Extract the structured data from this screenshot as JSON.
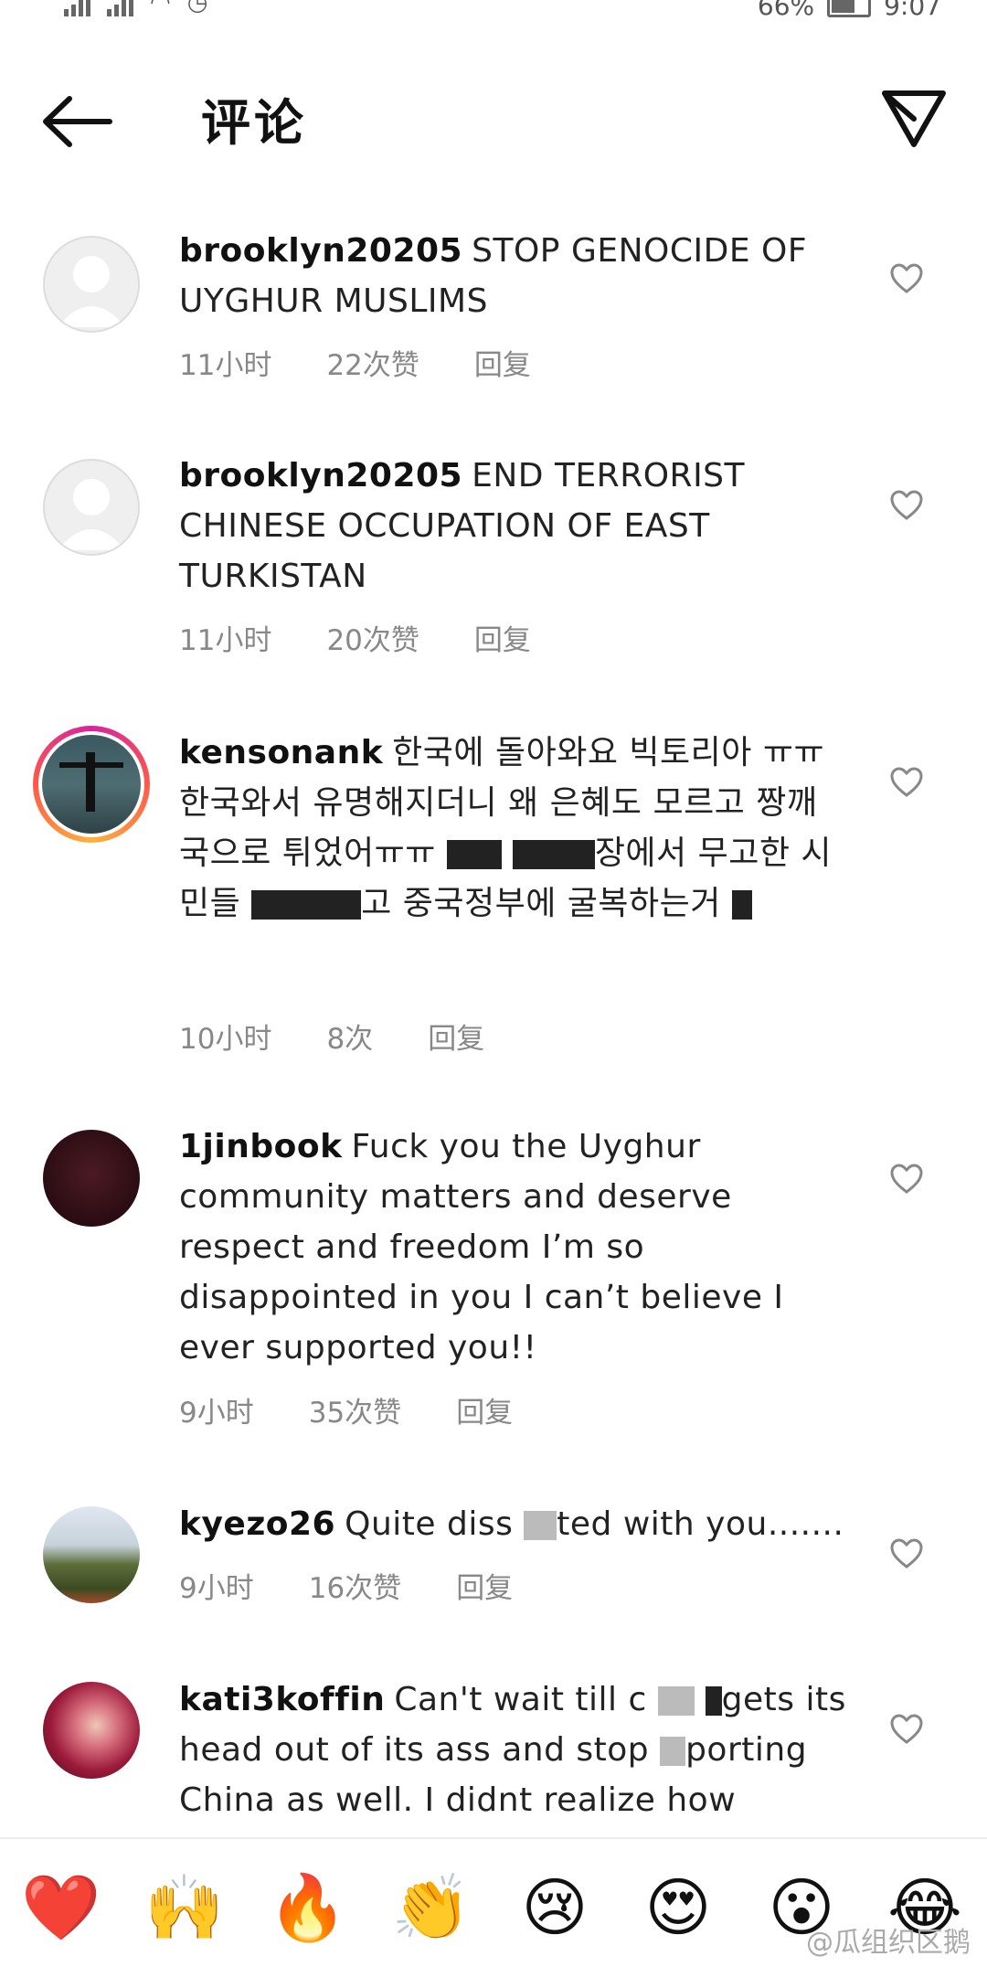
{
  "status_bar": {
    "battery": "66%",
    "time": "9:07"
  },
  "header": {
    "title": "评论"
  },
  "comments": [
    {
      "user": "brooklyn20205",
      "text": "STOP GENOCIDE OF UYGHUR MUSLIMS",
      "time": "11小时",
      "likes": "22次赞",
      "reply": "回复"
    },
    {
      "user": "brooklyn20205",
      "text": "END TERRORIST CHINESE OCCUPATION OF EAST TURKISTAN",
      "time": "11小时",
      "likes": "20次赞",
      "reply": "回复"
    },
    {
      "user": "kensonank",
      "text_a": "한국에 돌아와요 빅토리아 ㅠㅠ한국와서 유명해지더니 왜 은혜도 모르고 짱깨국으로 튀었어ㅠㅠ",
      "text_b": "장에서 무고한 시민들",
      "text_c": "고 중국정부에 굴복하는거",
      "time": "10小时",
      "likes": "8次",
      "reply": "回复"
    },
    {
      "user": "1jinbook",
      "text": "Fuck you the Uyghur community  matters and deserve respect and freedom I’m so disappointed in you I can’t believe I ever supported you!!",
      "time": "9小时",
      "likes": "35次赞",
      "reply": "回复"
    },
    {
      "user": "kyezo26",
      "text_a": "Quite diss",
      "text_b": "ted with you.......",
      "time": "9小时",
      "likes": "16次赞",
      "reply": "回复"
    },
    {
      "user": "kati3koffin",
      "text_a": "Can't wait till c",
      "text_b": "gets its head out of its ass and stop",
      "text_c": "porting China as well. I didnt realize how"
    }
  ],
  "emoji_bar": [
    "❤️",
    "🙌",
    "🔥",
    "👏",
    "😢",
    "😍",
    "😮",
    "😂"
  ],
  "watermark": "@瓜组织区鹅",
  "colors": {
    "text": "#111111",
    "meta": "#888888",
    "ring_gradient": [
      "#d6249f",
      "#fd5949",
      "#fdb13c"
    ]
  },
  "icons": [
    "back-arrow-icon",
    "send-icon",
    "heart-icon",
    "default-avatar-icon"
  ]
}
